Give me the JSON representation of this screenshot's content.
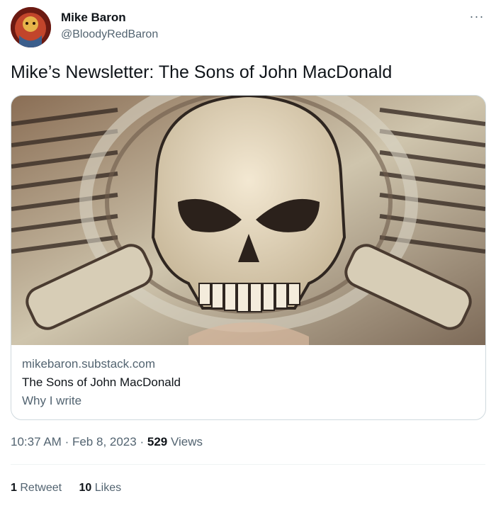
{
  "author": {
    "display_name": "Mike Baron",
    "handle": "@BloodyRedBaron"
  },
  "more_icon": "more-horizontal-icon",
  "tweet_text": "Mike’s Newsletter: The Sons of John MacDonald",
  "card": {
    "domain": "mikebaron.substack.com",
    "title": "The Sons of John MacDonald",
    "description": "Why I write",
    "image_alt": "skull over engine artwork"
  },
  "meta": {
    "time": "10:37 AM",
    "sep1": "·",
    "date": "Feb 8, 2023",
    "sep2": "·",
    "views_count": "529",
    "views_label": "Views"
  },
  "stats": {
    "retweets_count": "1",
    "retweets_label": "Retweet",
    "likes_count": "10",
    "likes_label": "Likes"
  },
  "colors": {
    "text": "#0f1419",
    "secondary": "#536471",
    "border": "#cfd9de"
  }
}
